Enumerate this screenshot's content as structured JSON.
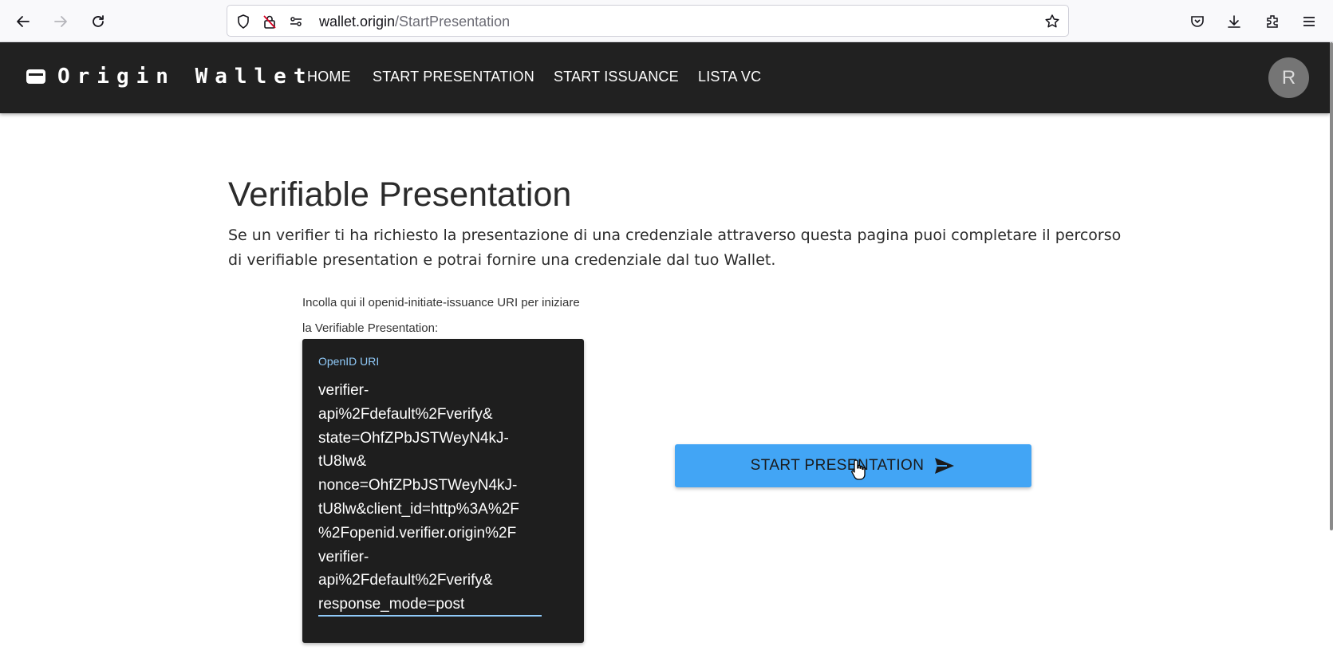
{
  "browser": {
    "url_host": "wallet.origin",
    "url_path": "/StartPresentation"
  },
  "header": {
    "brand": "Origin Wallet",
    "menu": [
      "HOME",
      "START PRESENTATION",
      "START ISSUANCE",
      "LISTA VC"
    ],
    "avatar_initial": "R"
  },
  "main": {
    "title": "Verifiable Presentation",
    "description": "Se un verifier ti ha richiesto la presentazione di una credenziale attraverso questa pagina puoi completare il percorso di verifiable presentation e potrai fornire una credenziale dal tuo Wallet.",
    "instructions": "Incolla qui il openid-initiate-issuance URI per iniziare la Verifiable Presentation:",
    "uri_field": {
      "label": "OpenID URI",
      "value": "verifier-\napi%2Fdefault%2Fverify&\nstate=OhfZPbJSTWeyN4kJ-\ntU8lw&\nnonce=OhfZPbJSTWeyN4kJ-\ntU8lw&client_id=http%3A%2F\n%2Fopenid.verifier.origin%2F\nverifier-\napi%2Fdefault%2Fverify&\nresponse_mode=post"
    },
    "start_button": "START PRESENTATION"
  },
  "colors": {
    "header_bg": "#212121",
    "button_bg": "#42a5f5",
    "field_bg": "#1e1e1e",
    "field_accent": "#90caf9"
  }
}
